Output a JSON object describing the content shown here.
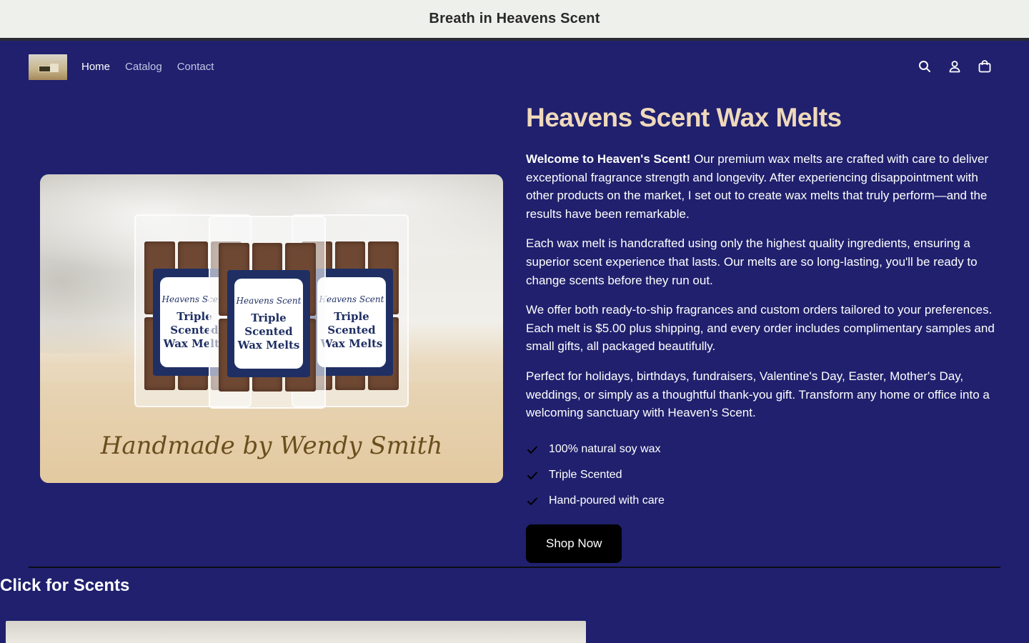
{
  "announcement": {
    "text": "Breath in Heavens Scent"
  },
  "header": {
    "nav": [
      {
        "label": "Home",
        "active": true
      },
      {
        "label": "Catalog",
        "active": false
      },
      {
        "label": "Contact",
        "active": false
      }
    ],
    "icons": [
      "search-icon",
      "account-icon",
      "cart-icon"
    ]
  },
  "hero": {
    "image": {
      "pack_brand": "Heavens Scent",
      "pack_name_line1": "Triple",
      "pack_name_line2": "Scented",
      "pack_name_line3": "Wax Melts",
      "signature": "Handmade by Wendy Smith"
    },
    "title": "Heavens Scent Wax Melts",
    "intro_bold": "Welcome to Heaven's Scent!",
    "intro_rest": " Our premium wax melts are crafted with care to deliver exceptional fragrance strength and longevity. After experiencing disappointment with other products on the market, I set out to create wax melts that truly perform—and the results have been remarkable.",
    "paragraph2": "Each wax melt is handcrafted using only the highest quality ingredients, ensuring a superior scent experience that lasts. Our melts are so long-lasting, you'll be ready to change scents before they run out.",
    "paragraph3": "We offer both ready-to-ship fragrances and custom orders tailored to your preferences. Each melt is $5.00 plus shipping, and every order includes complimentary samples and small gifts, all packaged beautifully.",
    "paragraph4": "Perfect for holidays, birthdays, fundraisers, Valentine's Day, Easter, Mother's Day, weddings, or simply as a thoughtful thank-you gift. Transform any home or office into a welcoming sanctuary with Heaven's Scent.",
    "features": [
      "100% natural soy wax",
      "Triple Scented",
      "Hand-poured with care"
    ],
    "cta": "Shop Now"
  },
  "scents_section": {
    "title": "Click for Scents"
  },
  "colors": {
    "background": "#20206e",
    "title_accent": "#efd9bb",
    "announcement_bg": "#eef0eb",
    "button_bg": "#000000"
  }
}
